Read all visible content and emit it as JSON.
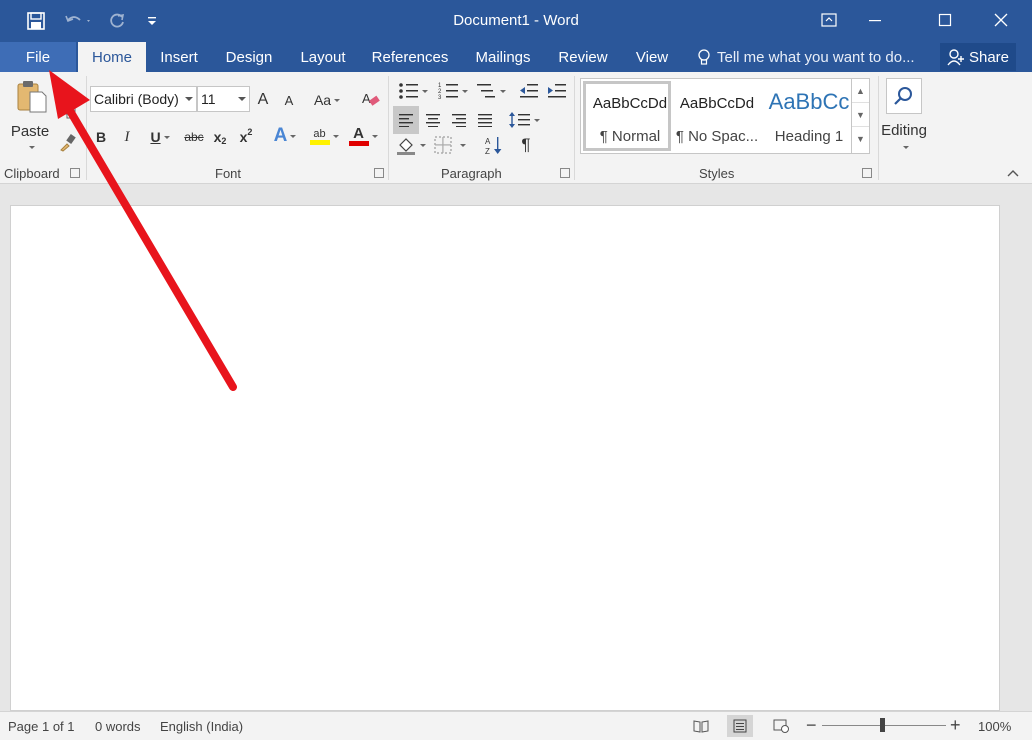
{
  "window": {
    "title": "Document1 - Word",
    "qat": {
      "save_icon": "save-icon",
      "undo_icon": "undo-icon",
      "redo_icon": "redo-icon",
      "customize_icon": "customize-icon"
    }
  },
  "tabs": [
    {
      "label": "File"
    },
    {
      "label": "Home"
    },
    {
      "label": "Insert"
    },
    {
      "label": "Design"
    },
    {
      "label": "Layout"
    },
    {
      "label": "References"
    },
    {
      "label": "Mailings"
    },
    {
      "label": "Review"
    },
    {
      "label": "View"
    }
  ],
  "tell_me": "Tell me what you want to do...",
  "share": "Share",
  "clipboard": {
    "label": "Clipboard",
    "paste": "Paste"
  },
  "font": {
    "label": "Font",
    "name": "Calibri (Body)",
    "size": "11",
    "change_case": "Aa",
    "bold": "B",
    "italic": "I",
    "underline": "U",
    "strike": "abc",
    "subscript": "x",
    "superscript": "x",
    "sub_mark": "2",
    "sup_mark": "2",
    "grow": "A",
    "shrink": "A",
    "effects": "A",
    "highlight": "ab",
    "color": "A"
  },
  "paragraph": {
    "label": "Paragraph",
    "pilcrow": "¶"
  },
  "styles": {
    "label": "Styles",
    "items": [
      {
        "sample": "AaBbCcDd",
        "name": "¶ Normal"
      },
      {
        "sample": "AaBbCcDd",
        "name": "¶ No Spac..."
      },
      {
        "sample": "AaBbCc",
        "name": "Heading 1"
      }
    ]
  },
  "editing": {
    "label": "Editing"
  },
  "status": {
    "page": "Page 1 of 1",
    "words": "0 words",
    "language": "English (India)",
    "zoom": "100%",
    "zoom_minus": "−",
    "zoom_plus": "+"
  },
  "colors": {
    "brand": "#2b579a",
    "arrow": "#e8141c"
  }
}
